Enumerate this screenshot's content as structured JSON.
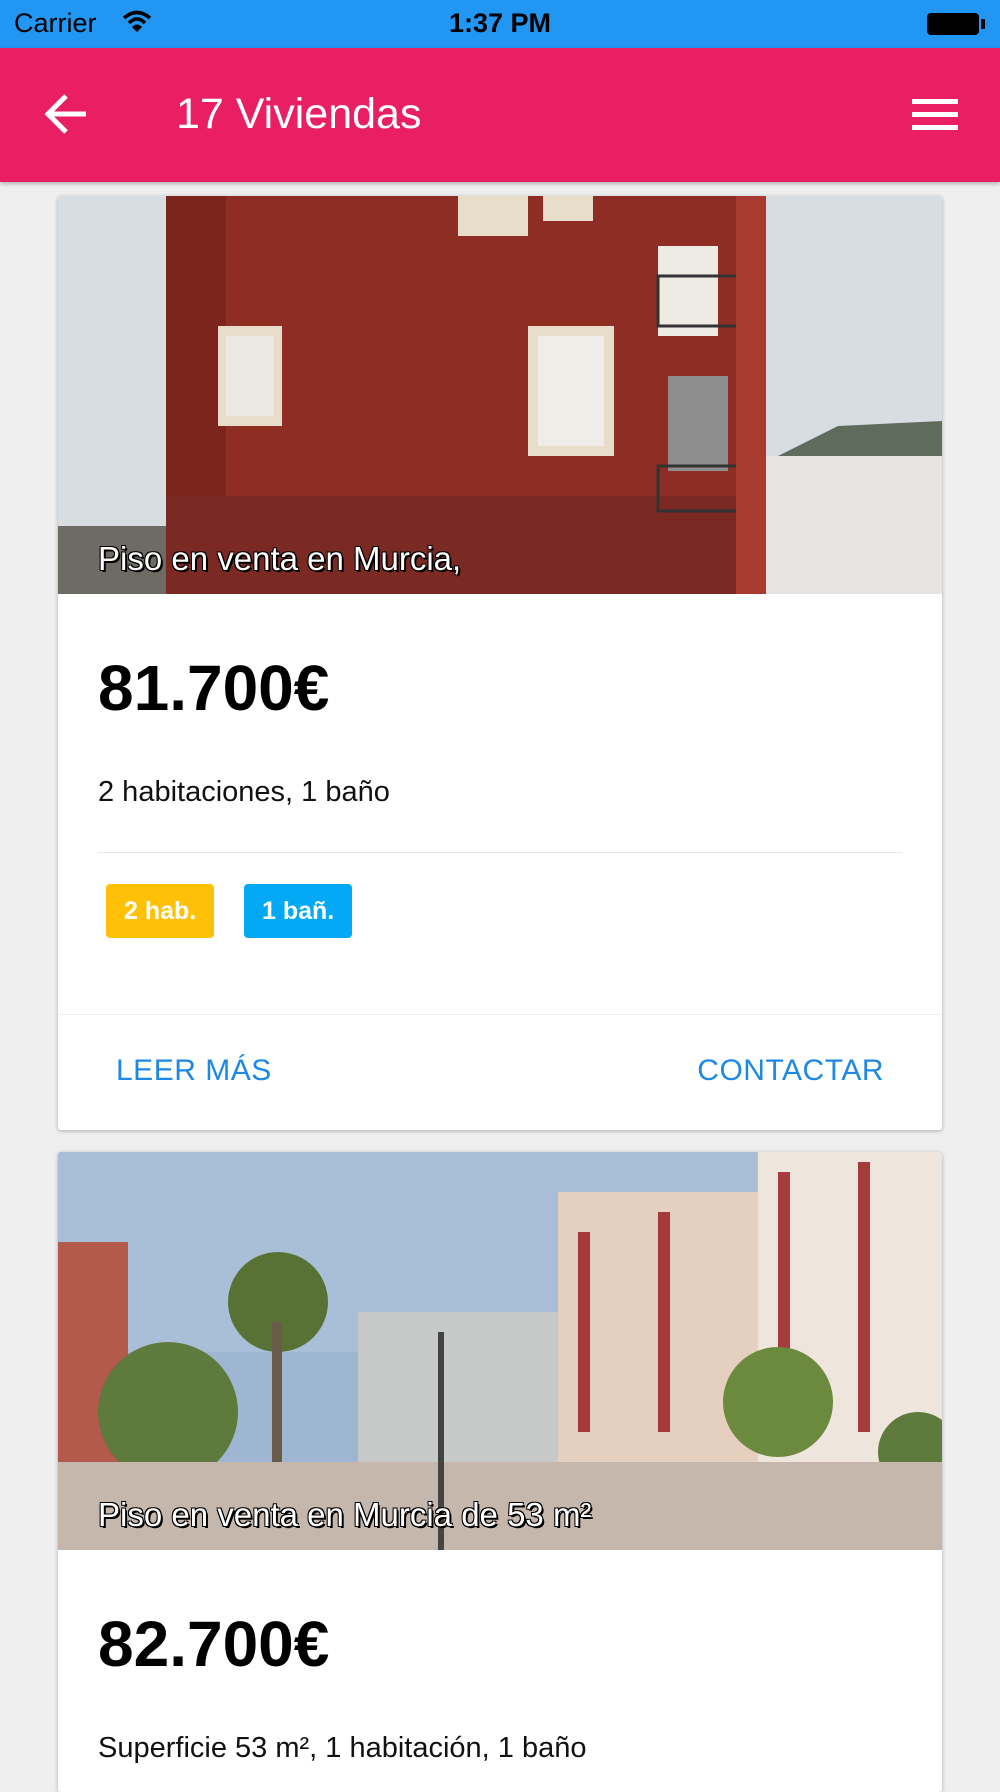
{
  "status_bar": {
    "carrier": "Carrier",
    "time": "1:37 PM"
  },
  "app_bar": {
    "title": "17 Viviendas"
  },
  "listings": [
    {
      "caption": "Piso en venta en Murcia,",
      "price": "81.700€",
      "description": "2 habitaciones, 1 baño",
      "badges": [
        {
          "label": "2 hab.",
          "color": "#ffc107"
        },
        {
          "label": "1 bañ.",
          "color": "#03a9f4"
        }
      ],
      "actions": {
        "read_more": "LEER MÁS",
        "contact": "CONTACTAR"
      }
    },
    {
      "caption": "Piso en venta en Murcia de 53 m²",
      "price": "82.700€",
      "description": "Superficie 53 m², 1 habitación, 1 baño"
    }
  ],
  "colors": {
    "status_bar": "#2196f3",
    "app_bar": "#e91e63",
    "action_text": "#1e88e5"
  }
}
